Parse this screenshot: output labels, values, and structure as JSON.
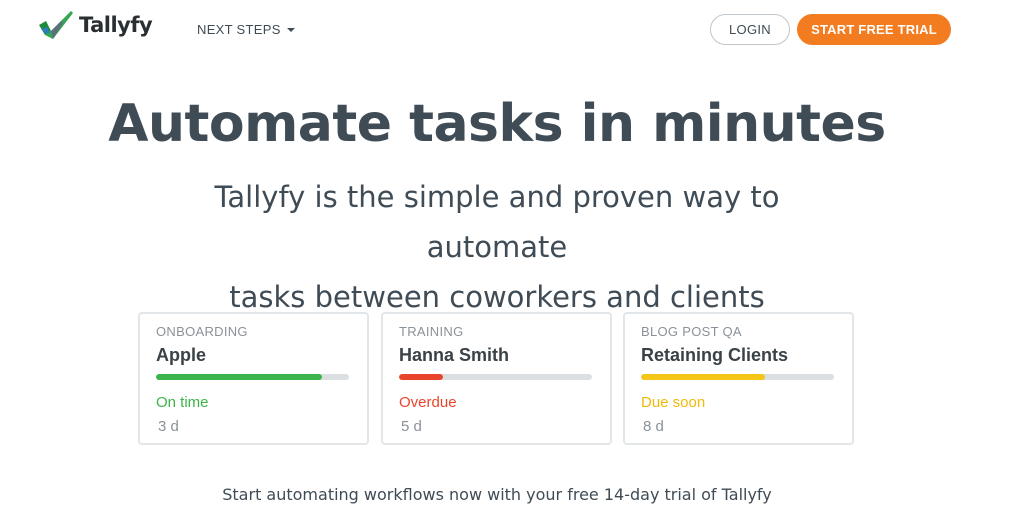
{
  "brand": {
    "name": "Tallyfy"
  },
  "nav": {
    "next_steps_label": "NEXT STEPS"
  },
  "header": {
    "login_label": "LOGIN",
    "trial_label": "START FREE TRIAL"
  },
  "hero": {
    "title": "Automate tasks in minutes",
    "subtitle_line1": "Tallyfy is the simple and proven way to automate",
    "subtitle_line2": "tasks between coworkers and clients"
  },
  "cards": [
    {
      "category": "ONBOARDING",
      "name": "Apple",
      "progress": 0.86,
      "bar_color": "#3cb44b",
      "status": "On time",
      "status_color": "#3cb44b",
      "days": "3 d"
    },
    {
      "category": "TRAINING",
      "name": "Hanna Smith",
      "progress": 0.23,
      "bar_color": "#e8452c",
      "status": "Overdue",
      "status_color": "#e8452c",
      "days": "5 d"
    },
    {
      "category": "BLOG POST QA",
      "name": "Retaining Clients",
      "progress": 0.64,
      "bar_color": "#f5c518",
      "status": "Due soon",
      "status_color": "#f0b90b",
      "days": "8 d"
    }
  ],
  "footer": {
    "text": "Start automating workflows now with your free 14-day trial of Tallyfy"
  },
  "colors": {
    "accent": "#f37b20",
    "text": "#3f4b55"
  },
  "icons": {
    "logo": "checkmark-logo-icon",
    "caret": "caret-down-icon"
  }
}
